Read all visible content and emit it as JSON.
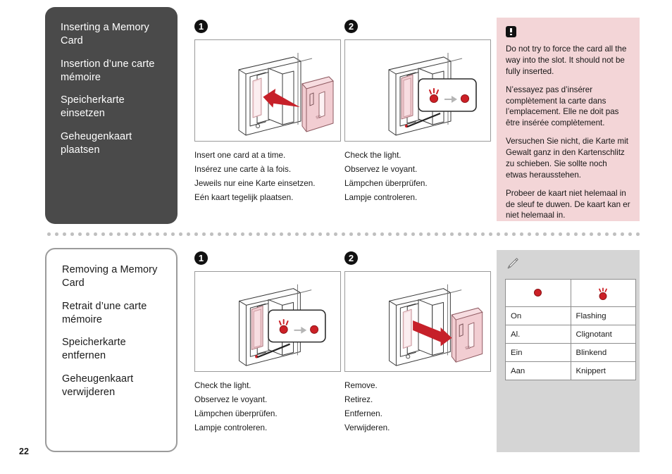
{
  "page": {
    "number": "22"
  },
  "sections": [
    {
      "id": "inserting",
      "headings": [
        "Inserting a Memory Card",
        "Insertion d’une carte mémoire",
        "Speicherkarte einsetzen",
        "Geheugenkaart plaatsen"
      ],
      "steps": [
        {
          "badge": "1",
          "figure": "memory-card-insert-illustration",
          "caption": [
            "Insert one card at a time.",
            "Insérez une carte à la fois.",
            "Jeweils nur eine Karte einsetzen.",
            "Eén kaart tegelijk plaatsen."
          ]
        },
        {
          "badge": "2",
          "figure": "memory-card-light-check-illustration",
          "caption": [
            "Check the light.",
            "Observez le voyant.",
            "Lämpchen überprüfen.",
            "Lampje controleren."
          ]
        }
      ]
    },
    {
      "id": "removing",
      "headings": [
        "Removing a Memory Card",
        "Retrait d’une carte mémoire",
        "Speicherkarte entfernen",
        "Geheugenkaart verwijderen"
      ],
      "steps": [
        {
          "badge": "1",
          "figure": "memory-card-light-check-illustration",
          "caption": [
            "Check the light.",
            "Observez le voyant.",
            "Lämpchen überprüfen.",
            "Lampje controleren."
          ]
        },
        {
          "badge": "2",
          "figure": "memory-card-remove-illustration",
          "caption": [
            "Remove.",
            "Retirez.",
            "Entfernen.",
            "Verwijderen."
          ]
        }
      ]
    }
  ],
  "caution": {
    "icon": "exclamation-icon",
    "background": "#f3d5d7",
    "paragraphs": [
      "Do not try to force the card all the way into the slot. It should not be fully inserted.",
      "N’essayez pas d’insérer complètement la carte dans l’emplacement. Elle ne doit pas être insérée complètement.",
      "Versuchen Sie nicht, die Karte mit Gewalt ganz in den Kartenschlitz zu schieben. Sie sollte noch etwas herausstehen.",
      "Probeer de kaart niet helemaal in de sleuf te duwen. De kaart kan er niet helemaal in."
    ]
  },
  "note": {
    "icon": "pencil-icon",
    "background": "#d5d5d5",
    "table": {
      "header_icons": [
        "lamp-on-icon",
        "lamp-flashing-icon"
      ],
      "rows": [
        [
          "On",
          "Flashing"
        ],
        [
          "Al.",
          "Clignotant"
        ],
        [
          "Ein",
          "Blinkend"
        ],
        [
          "Aan",
          "Knippert"
        ]
      ]
    }
  },
  "colors": {
    "lamp_red": "#cc2026",
    "card_pink": "#f2cdd2",
    "arrow_red": "#c62029",
    "panel_dark": "#4a4a4a",
    "panel_border": "#9b9b9b"
  }
}
